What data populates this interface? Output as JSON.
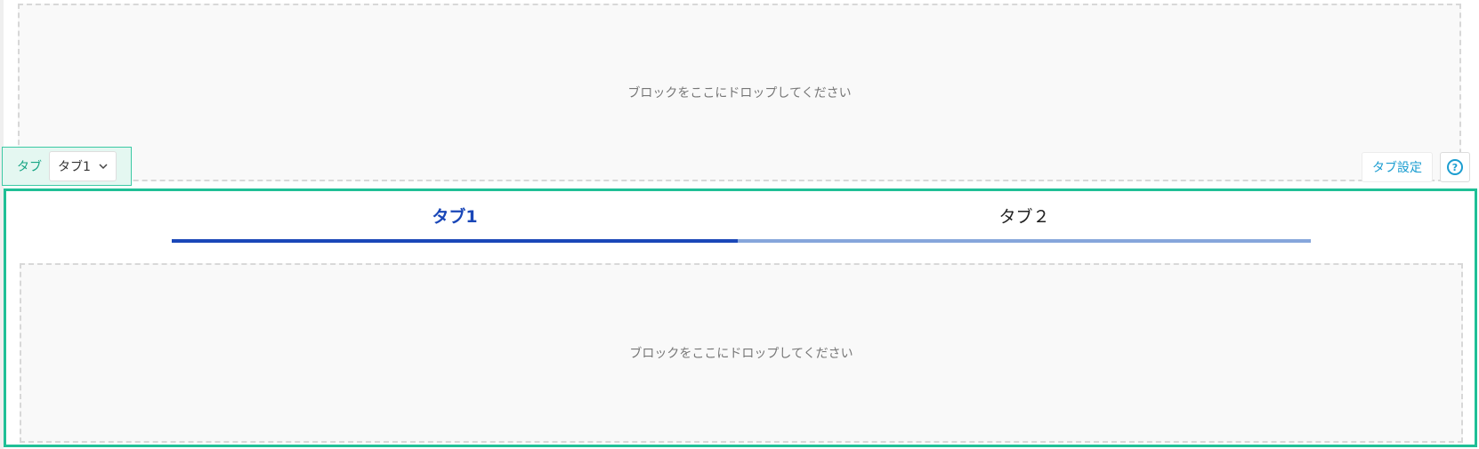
{
  "drop_zone_top": {
    "text": "ブロックをここにドロップしてください"
  },
  "tab_selector": {
    "label": "タブ",
    "selected": "タブ1"
  },
  "toolbar": {
    "tab_settings_label": "タブ設定",
    "help_label": "?"
  },
  "tabs": [
    {
      "label": "タブ1",
      "active": true
    },
    {
      "label": "タブ２",
      "active": false
    }
  ],
  "drop_zone_inner": {
    "text": "ブロックをここにドロップしてください"
  },
  "colors": {
    "accent_green": "#1fbf96",
    "active_tab_blue": "#1a47b8",
    "inactive_tab_blue": "#86a6db",
    "link_blue": "#1b9dd0"
  }
}
